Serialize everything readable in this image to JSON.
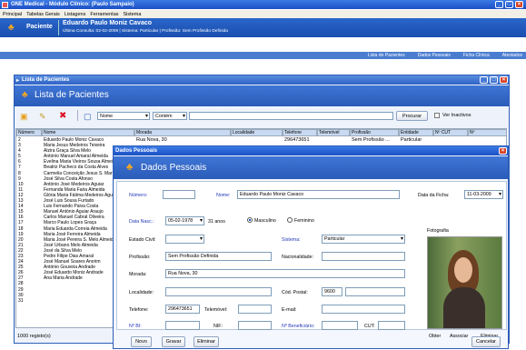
{
  "app": {
    "title": "ONE Medical - Módulo Clínico: (Paulo Sampaio)",
    "menu": [
      "Principal",
      "Tabelas Gerais",
      "Listagens",
      "Ferramentas",
      "Sistema"
    ]
  },
  "patient": {
    "tab": "Paciente",
    "name": "Eduardo Paulo Moniz Cavaco",
    "info": "Última Consulta: 02-02-2009  |  Sistema: Particular  |   Profissão: Sem Profissão Definida"
  },
  "nav": [
    "Lista de Pacientes",
    "Dados Pessoais",
    "Ficha Clínica",
    "Atestados"
  ],
  "list": {
    "window_title": "Lista de Pacientes",
    "heading": "Lista de Pacientes",
    "field_select": "Nome",
    "op_select": "Contém",
    "search_button": "Procurar",
    "inactive_label": "Ver Inactivos",
    "columns": [
      "Número",
      "Nome",
      "Morada",
      "Localidade",
      "Telefone",
      "Telemóvel",
      "Profissão",
      "Entidade",
      "Nº CUT",
      "Nº"
    ],
    "first_row": {
      "morada": "Rua Nova, 30",
      "telefone": "296473651",
      "profissao": "Sem Profissão ...",
      "entidade": "Particular"
    },
    "numbers": [
      "2",
      "3",
      "4",
      "5",
      "6",
      "7",
      "8",
      "9",
      "10",
      "11",
      "12",
      "13",
      "14",
      "15",
      "16",
      "17",
      "18",
      "19",
      "20",
      "21",
      "22",
      "23",
      "24",
      "25",
      "26",
      "27",
      "28",
      "29",
      "30",
      "31"
    ],
    "names": [
      "Eduardo Paulo Moniz Cavaco",
      "Maria Jesus Medeiros Teixeira",
      "Alzira Graça Silva Melo",
      "António Manuel Amaral Almeida",
      "Evelina Maria Vieiros Sousa Almeida",
      "Beatriz Pacheco da Costa Alves",
      "Carmelia Conceição Jesus S. Martins",
      "José Silva Costa Afonso",
      "António José Medeiros Aguiar",
      "Fernanda Maria Faria Almeida",
      "Glória Maria Fátima Medeiros Aguiar",
      "José Luis Sousa Furtado",
      "Luis Fernando Paiva Costa",
      "Manuel António Aguiar Araujo",
      "Carlos Manuel Cabral Oliveira",
      "Marco Paulo Lopes Graça",
      "Maria Eduarda Correia Almeida",
      "Maria José Ferreira Almeida",
      "Maria José Pereira S. Melo Almeida",
      "José Urbano Melo Almeida",
      "José da Silva Melo",
      "Pedro Filipe Dias Amaral",
      "José Manuel Soares Anorim",
      "António Gouveia Andrade",
      "José Eduardo Moniz Andrade",
      "Ana Maria Andrade",
      ""
    ],
    "footer": "1000 registo(s)"
  },
  "dados": {
    "window_title": "Dados Pessoais",
    "heading": "Dados Pessoais",
    "numero_label": "Número:",
    "nome_label": "Nome:",
    "nome_value": "Eduardo Paulo Moniz Cavaco",
    "data_ficha_label": "Data da Ficha:",
    "data_ficha_value": "11-03-2009",
    "nasc_label": "Data Nasc.:",
    "nasc_value": "05-02-1978",
    "idade": "31 anos",
    "masc": "Masculino",
    "fem": "Feminino",
    "civil_label": "Estado Civil:",
    "sistema_label": "Sistema:",
    "sistema_value": "Particular",
    "profissao_label": "Profissão:",
    "profissao_value": "Sem Profissão Definida",
    "nacionalidade_label": "Nacionalidade:",
    "morada_label": "Morada:",
    "morada_value": "Rua Nova, 30",
    "localidade_label": "Localidade:",
    "codpostal_label": "Cód. Postal:",
    "codpostal_value": "9600",
    "telefone_label": "Telefone:",
    "telefone_value": "296473651",
    "telemovel_label": "Telemóvel:",
    "email_label": "E-mail:",
    "nbi_label": "Nº BI:",
    "nif_label": "NIF:",
    "nbenef_label": "Nº Beneficiário:",
    "cut_label": "CUT:",
    "foto_label": "Fotografia",
    "obter": "Obter",
    "associar": "Associar",
    "eliminar_foto": "Eliminar",
    "novo": "Novo",
    "gravar": "Gravar",
    "eliminar": "Eliminar",
    "cancelar": "Cancelar"
  }
}
